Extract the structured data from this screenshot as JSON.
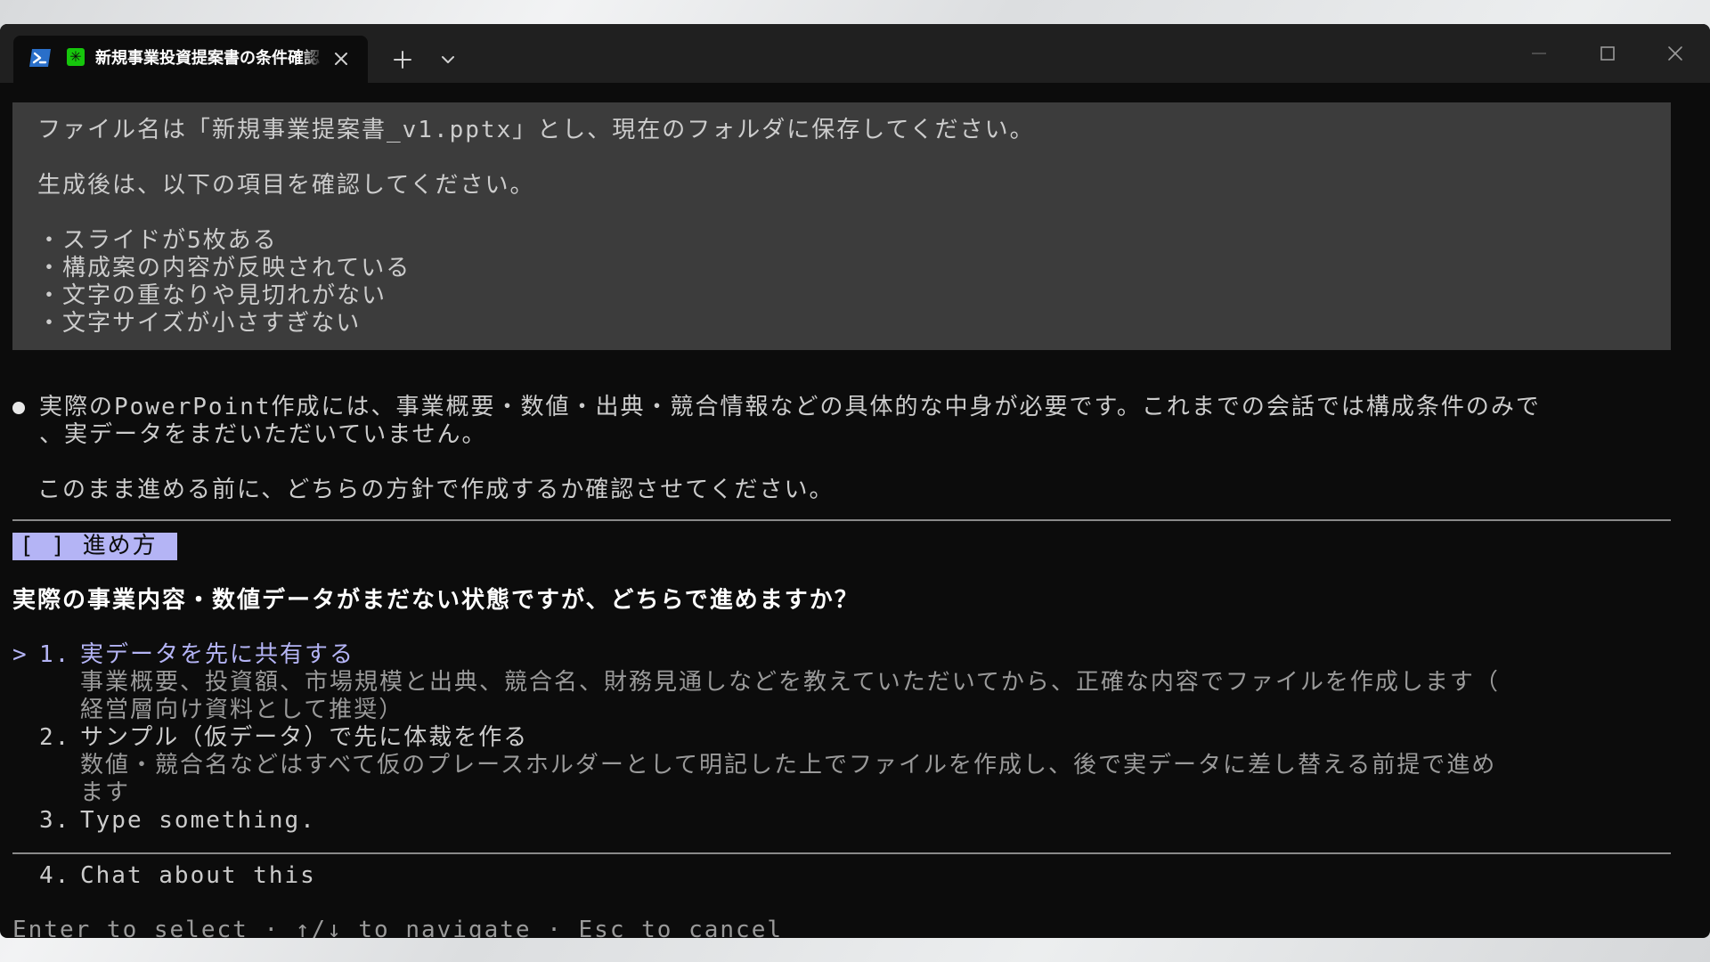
{
  "window": {
    "tab_title": "新規事業投資提案書の条件確認"
  },
  "prompt_block": {
    "line1": "ファイル名は「新規事業提案書_v1.pptx」とし、現在のフォルダに保存してください。",
    "line2": "生成後は、以下の項目を確認してください。",
    "checks": [
      "・スライドが5枚ある",
      "・構成案の内容が反映されている",
      "・文字の重なりや見切れがない",
      "・文字サイズが小さすぎない"
    ]
  },
  "assistant": {
    "line1": "実際のPowerPoint作成には、事業概要・数値・出典・競合情報などの具体的な中身が必要です。これまでの会話では構成条件のみで",
    "line2": "、実データをまだいただいていません。",
    "line3": "このまま進める前に、どちらの方針で作成するか確認させてください。"
  },
  "question": {
    "chip": "[ ] 進め方",
    "title": "実際の事業内容・数値データがまだない状態ですが、どちらで進めますか？",
    "selector": ">",
    "options": [
      {
        "number": "1.",
        "label": "実データを先に共有する",
        "desc1": "事業概要、投資額、市場規模と出典、競合名、財務見通しなどを教えていただいてから、正確な内容でファイルを作成します（",
        "desc2": "経営層向け資料として推奨）"
      },
      {
        "number": "2.",
        "label": "サンプル（仮データ）で先に体裁を作る",
        "desc1": "数値・競合名などはすべて仮のプレースホルダーとして明記した上でファイルを作成し、後で実データに差し替える前提で進め",
        "desc2": "ます"
      },
      {
        "number": "3.",
        "label": "Type something."
      },
      {
        "number": "4.",
        "label": "Chat about this"
      }
    ],
    "footer": "Enter to select · ↑/↓ to navigate · Esc to cancel"
  },
  "colors": {
    "terminal_bg": "#0c0c0c",
    "titlebar_bg": "#202020",
    "prompt_block_bg": "#3c3c3c",
    "accent": "#b4b4f5",
    "text": "#cccccc"
  }
}
